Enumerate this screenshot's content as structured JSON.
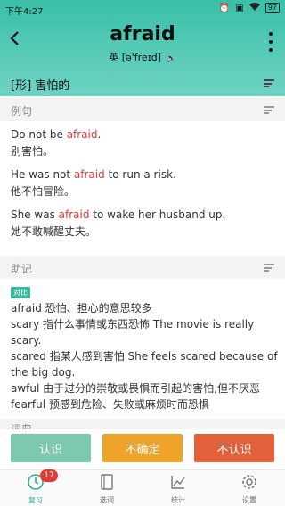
{
  "status": {
    "time": "下午4:27",
    "battery": "97"
  },
  "header": {
    "word": "afraid",
    "phonetic": "英 [ə'freɪd]"
  },
  "definition": "[形] 害怕的",
  "examples_section": {
    "title": "例句",
    "items": [
      {
        "en_pre": "Do not be ",
        "en_hl": "afraid",
        "en_post": ".",
        "zh": "别害怕。"
      },
      {
        "en_pre": "He was not ",
        "en_hl": "afraid",
        "en_post": " to run a risk.",
        "zh": "他不怕冒险。"
      },
      {
        "en_pre": "She was ",
        "en_hl": "afraid",
        "en_post": " to wake her husband up.",
        "zh": "她不敢喊醒丈夫。"
      }
    ]
  },
  "memory_section": {
    "title": "助记",
    "tag": "对比",
    "lines": [
      "afraid   恐怕、担心的意思较多",
      "scary   指什么事情或东西恐怖   The movie is really",
      "scary.",
      "scared 指某人感到害怕   She feels scared  because of",
      "the big dog.",
      "awful   由于过分的崇敬或畏惧而引起的害怕,但不厌恶",
      "fearful  预感到危险、失败或麻烦时而恐惧"
    ]
  },
  "next_section": {
    "title": "词典"
  },
  "buttons": {
    "know": "认识",
    "unsure": "不确定",
    "unknown": "不认识",
    "colors": {
      "know": "#7cc9b0",
      "unsure": "#f0a32a",
      "unknown": "#e2613a"
    }
  },
  "tabs": [
    {
      "label": "复习",
      "badge": "17"
    },
    {
      "label": "选词"
    },
    {
      "label": "统计"
    },
    {
      "label": "设置"
    }
  ]
}
